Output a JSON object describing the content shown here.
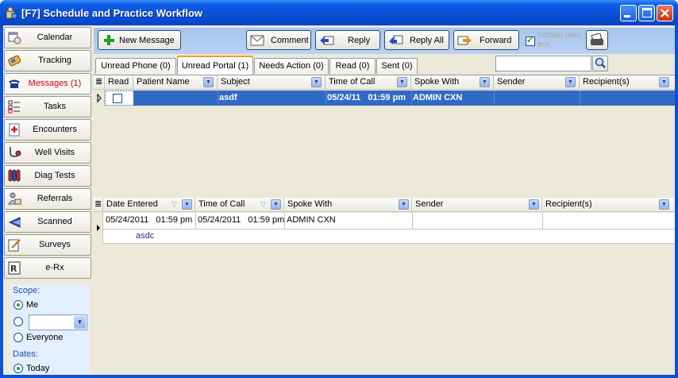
{
  "window": {
    "title": "[F7] Schedule and Practice Workflow"
  },
  "sidebar": {
    "items": [
      {
        "label": "Calendar",
        "icon": "calendar-icon"
      },
      {
        "label": "Tracking",
        "icon": "tracking-icon"
      },
      {
        "label": "Messages (1)",
        "icon": "phone-icon",
        "active": true
      },
      {
        "label": "Tasks",
        "icon": "tasks-icon"
      },
      {
        "label": "Encounters",
        "icon": "encounters-icon"
      },
      {
        "label": "Well Visits",
        "icon": "stethoscope-icon"
      },
      {
        "label": "Diag Tests",
        "icon": "test-tubes-icon"
      },
      {
        "label": "Referrals",
        "icon": "referrals-icon"
      },
      {
        "label": "Scanned",
        "icon": "scanner-icon"
      },
      {
        "label": "Surveys",
        "icon": "survey-icon"
      },
      {
        "label": "e-Rx",
        "icon": "rx-icon"
      }
    ],
    "scope": {
      "label": "Scope:",
      "options": [
        "Me",
        "",
        "Everyone"
      ],
      "selected": "Me",
      "combo_value": ""
    },
    "dates": {
      "label": "Dates:",
      "options": [
        "Today"
      ],
      "selected": "Today"
    }
  },
  "toolbar": {
    "new_message": "New Message",
    "comment": "Comment",
    "reply": "Reply",
    "reply_all": "Reply All",
    "forward": "Forward",
    "include_prior_text": "Include prior text",
    "include_checked": true
  },
  "tabs": [
    {
      "label": "Unread Phone (0)"
    },
    {
      "label": "Unread Portal (1)",
      "active": true
    },
    {
      "label": "Needs Action (0)"
    },
    {
      "label": "Read (0)"
    },
    {
      "label": "Sent (0)"
    }
  ],
  "search": {
    "value": ""
  },
  "message_grid": {
    "columns": [
      "Read",
      "Patient Name",
      "Subject",
      "Time of Call",
      "Spoke With",
      "Sender",
      "Recipient(s)"
    ],
    "rows": [
      {
        "read": "",
        "patient": "",
        "subject": "asdf",
        "time": "05/24/11   01:59 pm",
        "spoke_with": "ADMIN CXN",
        "sender": "",
        "recipients": ""
      }
    ]
  },
  "detail_grid": {
    "columns": [
      "Date Entered",
      "Time of Call",
      "Spoke With",
      "Sender",
      "Recipient(s)"
    ],
    "rows": [
      {
        "date_entered": "05/24/2011   01:59 pm",
        "time_of_call": "05/24/2011   01:59 pm",
        "spoke_with": "ADMIN CXN",
        "sender": "",
        "recipients": "",
        "note": "asdc"
      }
    ]
  },
  "colors": {
    "titlebar": "#0a50d8",
    "selection": "#316ac5",
    "active_nav": "#d8000c",
    "toolbar": "#a6c5ef"
  }
}
